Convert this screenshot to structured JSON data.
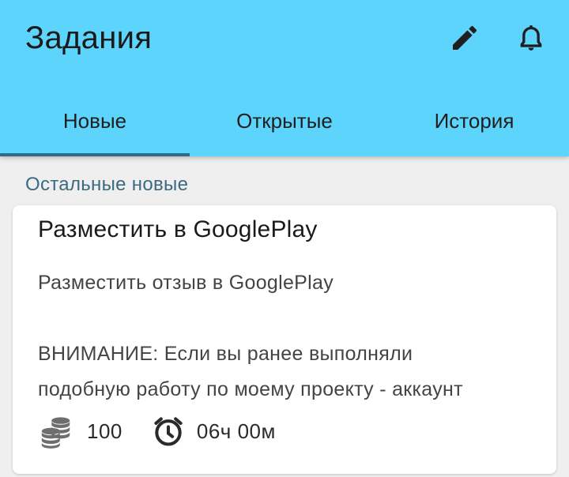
{
  "appbar": {
    "title": "Задания",
    "actions": [
      {
        "icon": "edit-icon"
      },
      {
        "icon": "bell-icon"
      }
    ],
    "background": "#5dd4fb"
  },
  "tabs": [
    {
      "label": "Новые",
      "active": true
    },
    {
      "label": "Открытые",
      "active": false
    },
    {
      "label": "История",
      "active": false
    }
  ],
  "section": {
    "label": "Остальные новые"
  },
  "task": {
    "title": "Разместить в GooglePlay",
    "description_line1": "Разместить отзыв в GooglePlay",
    "description_line2": "ВНИМАНИЕ: Если вы ранее выполняли",
    "description_line3": "подобную работу по моему проекту - аккаунт",
    "reward": "100",
    "reward_icon": "coins-icon",
    "time": "06ч 00м",
    "time_icon": "alarm-clock-icon"
  },
  "colors": {
    "accent": "#5dd4fb",
    "tab_indicator": "#2f6c89",
    "section_label": "#3b6a82"
  }
}
